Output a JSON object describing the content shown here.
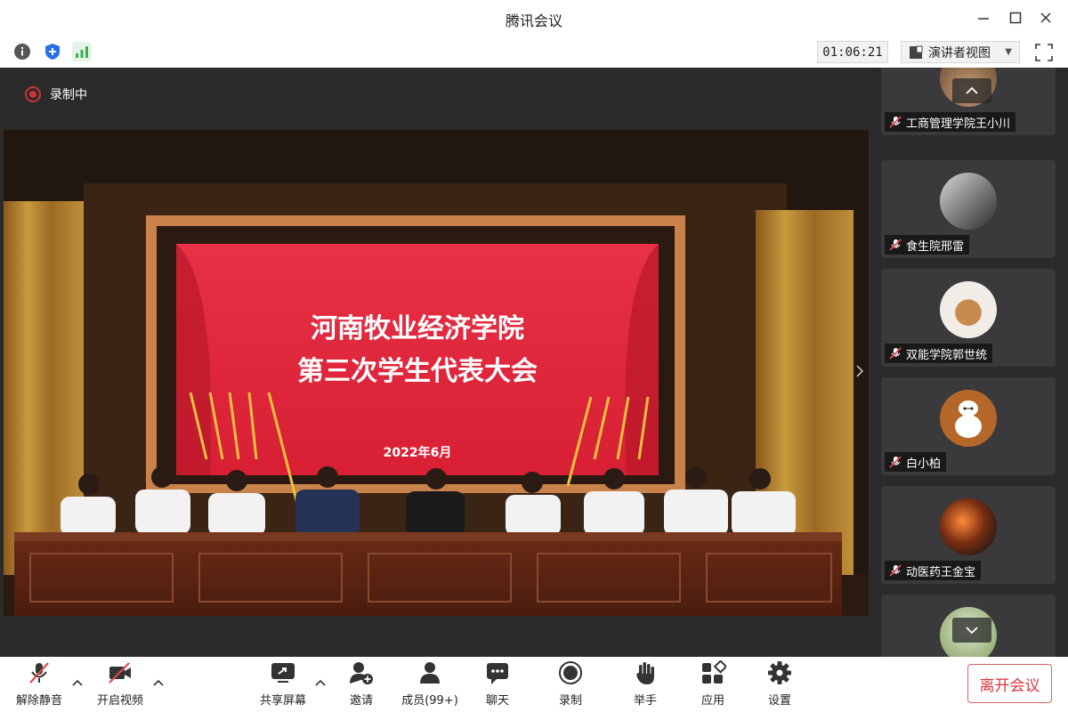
{
  "window": {
    "title": "腾讯会议"
  },
  "toolbar": {
    "timer": "01:06:21",
    "view_label": "演讲者视图"
  },
  "recording": {
    "label": "录制中"
  },
  "banner": {
    "line1": "河南牧业经济学院",
    "line2": "第三次学生代表大会",
    "date": "2022年6月"
  },
  "participants": [
    {
      "name": "工商管理学院王小川"
    },
    {
      "name": "食生院邢雷"
    },
    {
      "name": "双能学院郭世统"
    },
    {
      "name": "白小柏"
    },
    {
      "name": "动医药王金宝"
    }
  ],
  "bottom_bar": {
    "unmute": "解除静音",
    "start_video": "开启视频",
    "share_screen": "共享屏幕",
    "invite": "邀请",
    "members": "成员(99+)",
    "chat": "聊天",
    "record": "录制",
    "raise_hand": "举手",
    "apps": "应用",
    "settings": "设置",
    "leave": "离开会议"
  },
  "colors": {
    "accent_red": "#d9363e",
    "banner_red": "#e0283a",
    "shield_blue": "#2a6fe8",
    "signal_green": "#2fb34a"
  }
}
